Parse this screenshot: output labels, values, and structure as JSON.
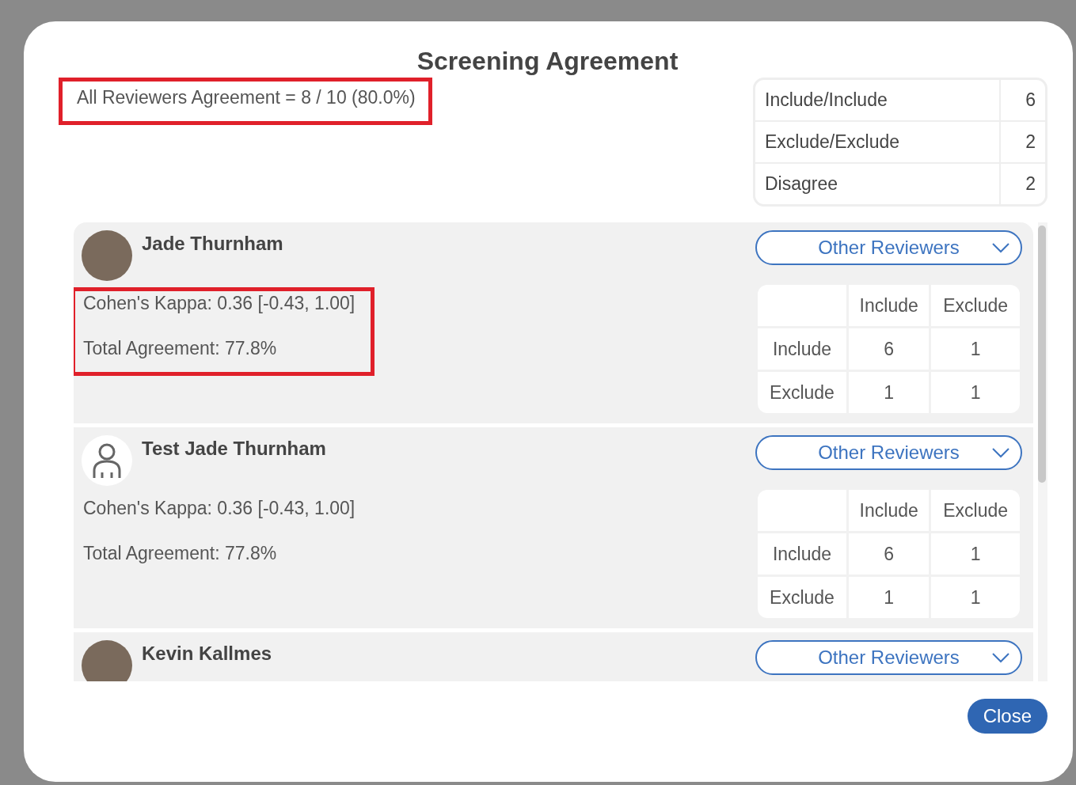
{
  "dialog": {
    "title": "Screening Agreement",
    "close_button": "Close"
  },
  "summary": {
    "text": "All Reviewers Agreement = 8 / 10 (80.0%)",
    "highlighted": true
  },
  "totals": [
    {
      "label": "Include/Include",
      "count": "6"
    },
    {
      "label": "Exclude/Exclude",
      "count": "2"
    },
    {
      "label": "Disagree",
      "count": "2"
    }
  ],
  "reviewers": [
    {
      "name": "Jade Thurnham",
      "kind": "photo",
      "dropdown": "Other Reviewers",
      "stats_highlighted": true,
      "kappa": "Cohen's Kappa: 0.36 [-0.43, 1.00]",
      "agreement": "Total Agreement: 77.8%",
      "matrix": {
        "columns": [
          "Include",
          "Exclude"
        ],
        "rows": [
          {
            "label": "Include",
            "cells": [
              "6",
              "1"
            ]
          },
          {
            "label": "Exclude",
            "cells": [
              "1",
              "1"
            ]
          }
        ]
      }
    },
    {
      "name": "Test Jade Thurnham",
      "kind": "default",
      "dropdown": "Other Reviewers",
      "stats_highlighted": false,
      "kappa": "Cohen's Kappa: 0.36 [-0.43, 1.00]",
      "agreement": "Total Agreement: 77.8%",
      "matrix": {
        "columns": [
          "Include",
          "Exclude"
        ],
        "rows": [
          {
            "label": "Include",
            "cells": [
              "6",
              "1"
            ]
          },
          {
            "label": "Exclude",
            "cells": [
              "1",
              "1"
            ]
          }
        ]
      }
    },
    {
      "name": "Kevin Kallmes",
      "kind": "photo",
      "dropdown": "Other Reviewers"
    }
  ]
}
